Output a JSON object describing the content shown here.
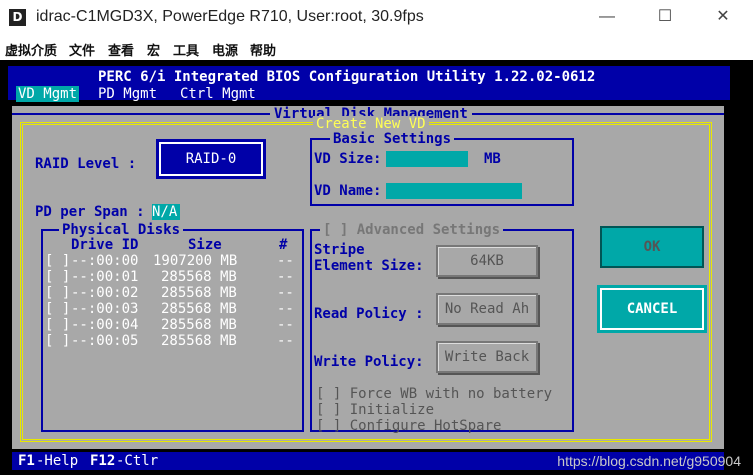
{
  "window": {
    "title": "idrac-C1MGD3X, PowerEdge R710, User:root, 30.9fps",
    "app_icon": "D"
  },
  "menu": [
    "虚拟介质",
    "文件",
    "查看",
    "宏",
    "工具",
    "电源",
    "帮助"
  ],
  "bios": {
    "title": "PERC 6/i Integrated BIOS Configuration Utility 1.22.02-0612",
    "tabs": [
      "VD Mgmt",
      "PD Mgmt",
      "Ctrl Mgmt"
    ],
    "panel_title": "Virtual Disk Management",
    "dialog_title": "Create New VD",
    "raid_level_label": "RAID Level :",
    "raid_level_value": "RAID-0",
    "pd_per_span_label": "PD per Span :",
    "pd_per_span_value": "N/A",
    "physical_disks": {
      "title": "Physical Disks",
      "headers": [
        "Drive ID",
        "Size",
        "#"
      ],
      "rows": [
        {
          "check": "[ ]",
          "id": "--:00:00",
          "size": "1907200 MB",
          "num": "--"
        },
        {
          "check": "[ ]",
          "id": "--:00:01",
          "size": "285568 MB",
          "num": "--"
        },
        {
          "check": "[ ]",
          "id": "--:00:02",
          "size": "285568 MB",
          "num": "--"
        },
        {
          "check": "[ ]",
          "id": "--:00:03",
          "size": "285568 MB",
          "num": "--"
        },
        {
          "check": "[ ]",
          "id": "--:00:04",
          "size": "285568 MB",
          "num": "--"
        },
        {
          "check": "[ ]",
          "id": "--:00:05",
          "size": "285568 MB",
          "num": "--"
        }
      ]
    },
    "basic_settings": {
      "title": "Basic Settings",
      "vd_size_label": "VD Size:",
      "vd_size_value": "",
      "vd_size_unit": "MB",
      "vd_name_label": "VD Name:",
      "vd_name_value": ""
    },
    "advanced_settings": {
      "title": "[ ] Advanced Settings",
      "stripe_label_1": "Stripe",
      "stripe_label_2": "Element Size:",
      "stripe_value": "64KB",
      "read_policy_label": "Read Policy :",
      "read_policy_value": "No Read Ah",
      "write_policy_label": "Write Policy:",
      "write_policy_value": "Write Back",
      "options": [
        "[ ] Force WB with no battery",
        "[ ] Initialize",
        "[ ] Configure HotSpare"
      ]
    },
    "buttons": {
      "ok": "OK",
      "cancel": "CANCEL"
    },
    "footer": [
      {
        "key": "F1",
        "action": "-Help"
      },
      {
        "key": "F12",
        "action": "-Ctlr"
      }
    ]
  },
  "watermark": "https://blog.csdn.net/g950904",
  "colors": {
    "bios_blue": "#0000a8",
    "bios_cyan": "#00a8a8",
    "bios_gray": "#a8a8a8",
    "dialog_yellow": "#ffff54"
  }
}
